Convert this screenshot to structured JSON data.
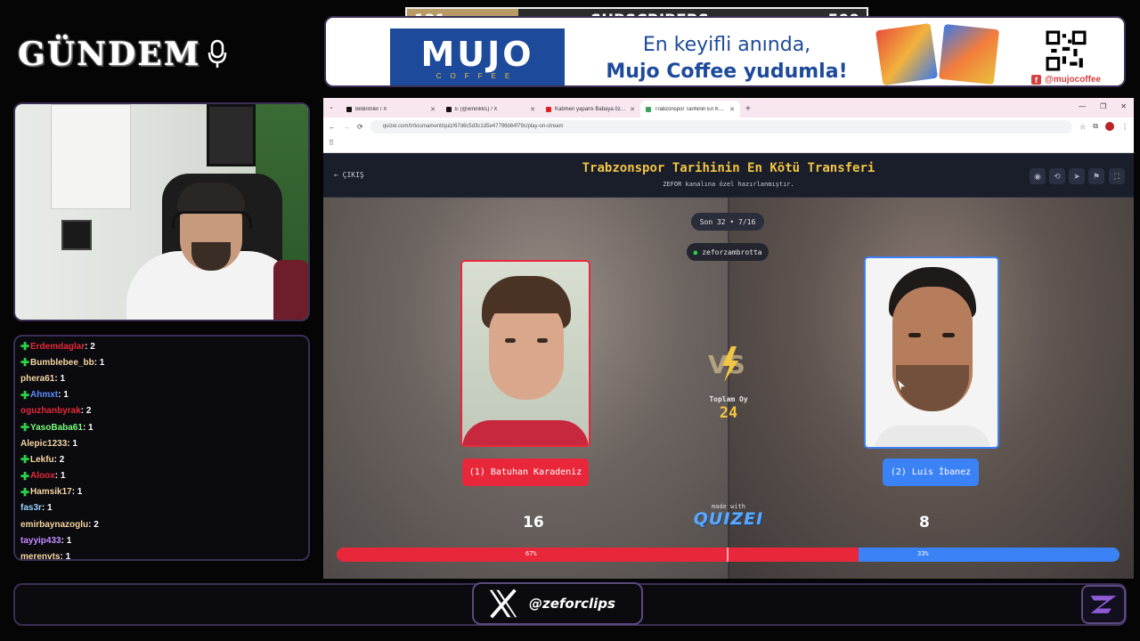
{
  "overlay": {
    "logo_text": "GÜNDEM",
    "subscribers": {
      "current": "121",
      "label": "SUBSCRIBERS",
      "goal": "500",
      "progress": 0.242
    },
    "ad": {
      "brand": "MUJO",
      "brand_sub": "COFFEE",
      "line1": "En keyifli anında,",
      "line2": "Mujo Coffee yudumla!",
      "social": "@mujocoffee"
    },
    "social_handle": "@zeforclips"
  },
  "chat": [
    {
      "name": "Erdemdaglar",
      "count": ": 2",
      "color": "#e8283a",
      "plus": true
    },
    {
      "name": "Bumblebee_bb",
      "count": ": 1",
      "color": "#f5d6a0",
      "plus": true
    },
    {
      "name": "phera61",
      "count": ": 1",
      "color": "#f5d6a0",
      "plus": false
    },
    {
      "name": "Ahmxt",
      "count": ": 1",
      "color": "#5b8cff",
      "plus": true
    },
    {
      "name": "oguzhanbyrak",
      "count": ": 2",
      "color": "#e8283a",
      "plus": false
    },
    {
      "name": "YasoBaba61",
      "count": ": 1",
      "color": "#7cff7c",
      "plus": true
    },
    {
      "name": "Alepic1233",
      "count": ": 1",
      "color": "#f5d6a0",
      "plus": false
    },
    {
      "name": "Lekfu",
      "count": ": 2",
      "color": "#f5d6a0",
      "plus": true
    },
    {
      "name": "Aloox",
      "count": ": 1",
      "color": "#e8283a",
      "plus": true
    },
    {
      "name": "Hamsik17",
      "count": ": 1",
      "color": "#f5d6a0",
      "plus": true
    },
    {
      "name": "fas3r",
      "count": ": 1",
      "color": "#9ad0ff",
      "plus": false
    },
    {
      "name": "emirbaynazoglu",
      "count": ": 2",
      "color": "#f5d6a0",
      "plus": false
    },
    {
      "name": "tayyip433",
      "count": ": 1",
      "color": "#c58cff",
      "plus": false
    },
    {
      "name": "merenvts",
      "count": ": 1",
      "color": "#f5d6a0",
      "plus": false
    }
  ],
  "browser": {
    "tabs": [
      {
        "label": "Bildirimler / X",
        "active": false
      },
      {
        "label": "E (@emirik61) / X",
        "active": false
      },
      {
        "label": "Kabmen yapamı Babaya özel 🎈 -",
        "active": false
      },
      {
        "label": "Trabzonspor Tarihinin En Kötü T",
        "active": true
      }
    ],
    "url": "quizei.com/tr/tournament/quiz/67d6c5d3c1d5e47796b84f79c/play-on-stream"
  },
  "quiz": {
    "exit_label": "ÇIKIŞ",
    "title": "Trabzonspor Tarihinin En Kötü Transferi",
    "subtitle": "ZEFOR kanalına özel hazırlanmıştır.",
    "round": "Son 32 • 7/16",
    "user": "zeforzambrotta",
    "total_label": "Toplam Oy",
    "total_votes": "24",
    "left": {
      "name": "(1) Batuhan Karadeniz",
      "votes": "16",
      "percent": "67%",
      "share": 0.667
    },
    "right": {
      "name": "(2) Luis İbanez",
      "votes": "8",
      "percent": "33%"
    },
    "made_with": "made with",
    "brand": "QUIZEI"
  },
  "colors": {
    "left_accent": "#e8283a",
    "right_accent": "#3b82f6",
    "title_gold": "#f2c542"
  }
}
